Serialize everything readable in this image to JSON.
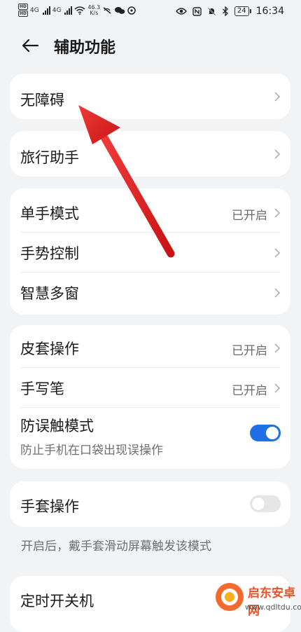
{
  "status_bar": {
    "left": {
      "network_badges": [
        "HD",
        "HD"
      ],
      "network_types": [
        "4G",
        "4G"
      ],
      "speed_value": "46.3",
      "speed_unit": "K/s"
    },
    "right": {
      "battery_level": "24",
      "time": "16:34"
    }
  },
  "header": {
    "back_icon": "arrow-left-icon",
    "title": "辅助功能"
  },
  "cards": {
    "accessibility": {
      "label": "无障碍"
    },
    "travel": {
      "label": "旅行助手"
    },
    "group1": {
      "one_hand": {
        "label": "单手模式",
        "value": "已开启"
      },
      "gestures": {
        "label": "手势控制"
      },
      "multi_window": {
        "label": "智慧多窗"
      }
    },
    "group2": {
      "cover": {
        "label": "皮套操作",
        "value": "已开启"
      },
      "stylus": {
        "label": "手写笔",
        "value": "已开启"
      },
      "anti_mistouch": {
        "label": "防误触模式",
        "sub": "防止手机在口袋出现误操作",
        "enabled": true
      }
    },
    "glove": {
      "label": "手套操作",
      "enabled": false
    },
    "glove_hint": "开启后，戴手套滑动屏幕触发该模式",
    "timer": {
      "label": "定时开关机"
    }
  },
  "watermark": {
    "name": "启东安卓网",
    "url": "www.qdltdu.com"
  },
  "colors": {
    "toggle_on": "#1f6fe5",
    "toggle_off": "#e6e6e6",
    "annotation_arrow": "#e02020",
    "background": "#f1f3f5"
  }
}
